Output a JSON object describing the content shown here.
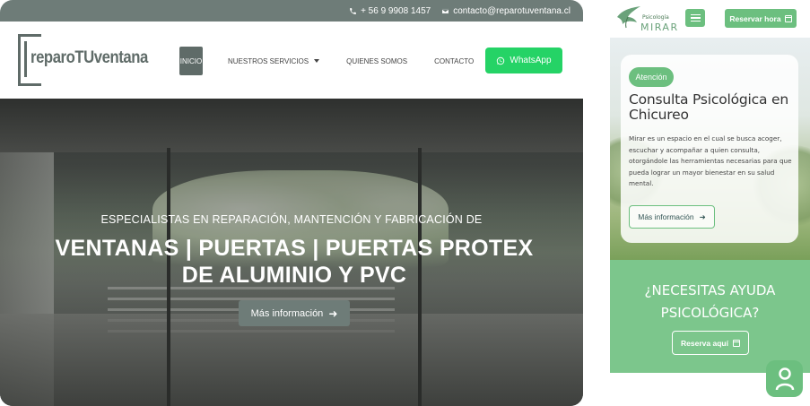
{
  "left_site": {
    "topbar": {
      "phone": "+ 56 9 9908 1457",
      "email": "contacto@reparotuventana.cl"
    },
    "logo": {
      "text": "reparoTUventana"
    },
    "nav": {
      "items": [
        {
          "label": "INICIO",
          "active": true
        },
        {
          "label": "NUESTROS SERVICIOS",
          "active": false
        },
        {
          "label": "QUIENES SOMOS",
          "active": false
        },
        {
          "label": "CONTACTO",
          "active": false
        }
      ]
    },
    "whatsapp_button": "WhatsApp",
    "hero": {
      "subtitle": "ESPECIALISTAS EN REPARACIÓN, MANTENCIÓN Y FABRICACIÓN DE",
      "title_line1": "VENTANAS | PUERTAS | PUERTAS PROTEX",
      "title_line2": "DE ALUMINIO Y PVC",
      "button": "Más información"
    },
    "colors": {
      "brand": "#6e7c78",
      "whatsapp": "#25d366"
    }
  },
  "right_site": {
    "logo": {
      "small": "Psicología",
      "big": "MIRAR"
    },
    "reserve_button": "Reservar hora",
    "card": {
      "tag": "Atención",
      "title": "Consulta Psicológica en Chicureo",
      "text": "Mirar es un espacio en el cual se busca acoger, escuchar y acompañar a quien consulta, otorgándole las herramientas necesarias para que pueda lograr un mayor bienestar en su salud mental.",
      "button": "Más información"
    },
    "cta": {
      "title_line1": "¿NECESITAS AYUDA",
      "title_line2": "PSICOLÓGICA?",
      "button": "Reserva aquí"
    },
    "colors": {
      "accent": "#6cbf7f",
      "cta_bg": "#7cc68c"
    }
  }
}
